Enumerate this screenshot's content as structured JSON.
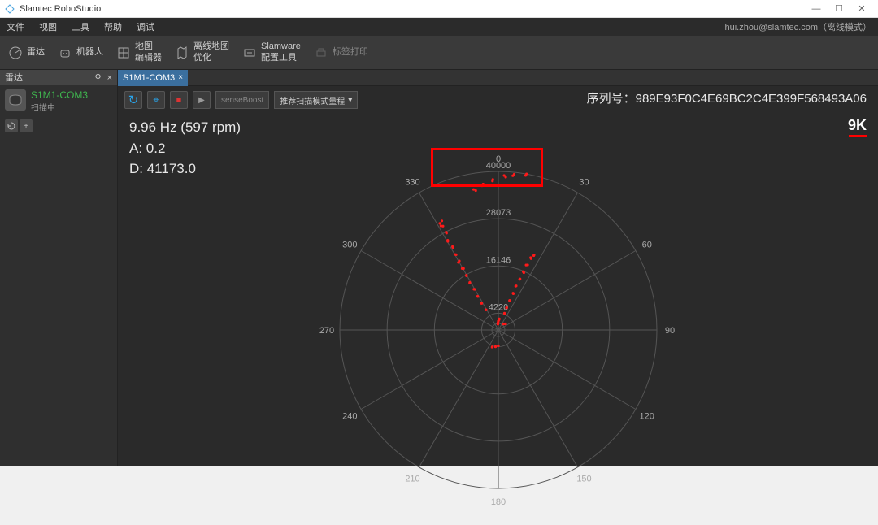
{
  "window": {
    "title": "Slamtec RoboStudio",
    "controls": {
      "minimize": "—",
      "maximize": "☐",
      "close": "✕"
    }
  },
  "menu": {
    "file": "文件",
    "view": "视图",
    "tools": "工具",
    "help": "帮助",
    "debug": "调试",
    "user_info": "hui.zhou@slamtec.com（离线模式）"
  },
  "toolbar": {
    "radar": "雷达",
    "robot": "机器人",
    "map_editor": "地图\n编辑器",
    "offline_map": "离线地图\n优化",
    "slamware": "Slamware\n配置工具",
    "print": "标签打印"
  },
  "sidebar": {
    "panel_title": "雷达",
    "panel_pin": "⚲",
    "panel_close": "×",
    "device_name": "S1M1-COM3",
    "device_status": "扫描中"
  },
  "tab": {
    "label": "S1M1-COM3",
    "close": "×"
  },
  "controls": {
    "refresh": "↻",
    "crosshair": "⌖",
    "stop": "■",
    "play": "▶",
    "field_value": "senseBoost",
    "dropdown_label": "推荐扫描模式量程",
    "dropdown_caret": "▾"
  },
  "stats": {
    "freq_line": "9.96 Hz (597 rpm)",
    "a_line": "A: 0.2",
    "d_line": "D: 41173.0"
  },
  "serial": {
    "label": "序列号：",
    "value": "989E93F0C4E69BC2C4E399F568493A06"
  },
  "badge": "9K",
  "chart_data": {
    "type": "scatter",
    "title": "LIDAR Polar Scan",
    "angle_unit": "degrees",
    "distance_unit": "mm",
    "angle_ticks": [
      0,
      30,
      60,
      90,
      120,
      150,
      180,
      210,
      240,
      270,
      300,
      330
    ],
    "ring_values": [
      4220,
      16146,
      28073,
      40000
    ],
    "radial_max": 40000,
    "clusters": [
      {
        "angle_range": [
          328,
          332
        ],
        "distances": [
          6000,
          8000,
          10000,
          12000,
          14000,
          16000,
          18000,
          20000,
          22000,
          24000,
          26000,
          28000,
          30000,
          31000
        ]
      },
      {
        "angle_range": [
          350,
          10
        ],
        "distances": [
          36000,
          37000,
          38000,
          39000,
          39500,
          40000
        ]
      },
      {
        "angle_range": [
          20,
          25
        ],
        "distances": [
          4500,
          6000,
          8000,
          10000,
          12000,
          14000,
          16000,
          18000,
          20000,
          21000
        ]
      },
      {
        "angle_range": [
          355,
          5
        ],
        "distances": [
          1500,
          1800,
          2200,
          2600,
          2800
        ]
      },
      {
        "angle_range": [
          40,
          50
        ],
        "distances": [
          2000,
          2400
        ]
      },
      {
        "angle_range": [
          180,
          200
        ],
        "distances": [
          4000,
          4300,
          4600
        ]
      }
    ]
  },
  "ring_labels": {
    "r0": "4220",
    "r1": "16146",
    "r2": "28073",
    "r3": "40000"
  },
  "ang_labels": {
    "a0": "0",
    "a30": "30",
    "a60": "60",
    "a90": "90",
    "a120": "120",
    "a150": "150",
    "a180": "180",
    "a210": "210",
    "a240": "240",
    "a270": "270",
    "a300": "300",
    "a330": "330"
  }
}
